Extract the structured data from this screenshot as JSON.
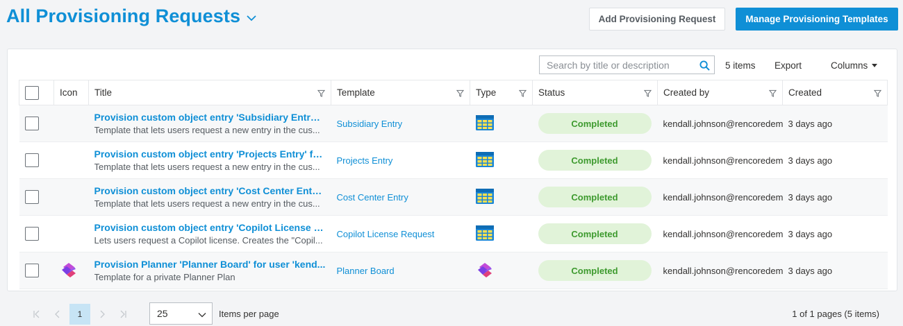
{
  "header": {
    "title": "All Provisioning Requests",
    "add_button": "Add Provisioning Request",
    "manage_button": "Manage Provisioning Templates",
    "accent_color": "#0f8fd6"
  },
  "toolbar": {
    "search_placeholder": "Search by title or description",
    "items_count": "5 items",
    "export_label": "Export",
    "columns_label": "Columns"
  },
  "table": {
    "columns": [
      "Icon",
      "Title",
      "Template",
      "Type",
      "Status",
      "Created by",
      "Created"
    ],
    "rows": [
      {
        "icon": "",
        "title": "Provision custom object entry 'Subsidiary Entry'...",
        "description": "Template that lets users request a new entry in the cus...",
        "template": "Subsidiary Entry",
        "type_icon": "list-table-icon",
        "status": "Completed",
        "created_by": "kendall.johnson@rencoredemo",
        "created": "3 days ago"
      },
      {
        "icon": "",
        "title": "Provision custom object entry 'Projects Entry' fo...",
        "description": "Template that lets users request a new entry in the cus...",
        "template": "Projects Entry",
        "type_icon": "list-table-icon",
        "status": "Completed",
        "created_by": "kendall.johnson@rencoredemo",
        "created": "3 days ago"
      },
      {
        "icon": "",
        "title": "Provision custom object entry 'Cost Center Entry...",
        "description": "Template that lets users request a new entry in the cus...",
        "template": "Cost Center Entry",
        "type_icon": "list-table-icon",
        "status": "Completed",
        "created_by": "kendall.johnson@rencoredemo",
        "created": "3 days ago"
      },
      {
        "icon": "",
        "title": "Provision custom object entry 'Copilot License R...",
        "description": "Lets users request a Copilot license. Creates the \"Copil...",
        "template": "Copilot License Request",
        "type_icon": "list-table-icon",
        "status": "Completed",
        "created_by": "kendall.johnson@rencoredemo",
        "created": "3 days ago"
      },
      {
        "icon": "planner-icon",
        "title": "Provision Planner 'Planner Board' for user 'kend...",
        "description": "Template for a private Planner Plan",
        "template": "Planner Board",
        "type_icon": "planner-icon",
        "status": "Completed",
        "created_by": "kendall.johnson@rencoredemo",
        "created": "3 days ago"
      }
    ]
  },
  "pagination": {
    "current_page": "1",
    "page_size": "25",
    "items_per_page_label": "Items per page",
    "info": "1 of 1 pages (5 items)"
  }
}
